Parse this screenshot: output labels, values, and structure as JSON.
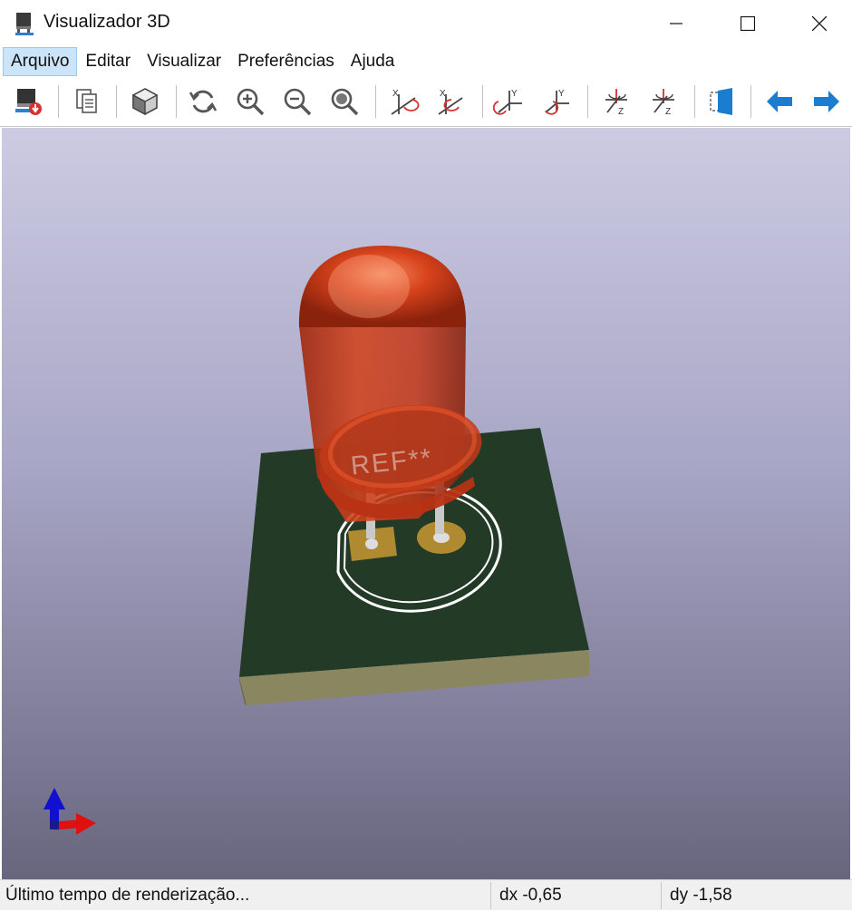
{
  "window": {
    "title": "Visualizador 3D"
  },
  "menu": [
    "Arquivo",
    "Editar",
    "Visualizar",
    "Preferências",
    "Ajuda"
  ],
  "viewport": {
    "silkscreen_text": "REF**"
  },
  "status": {
    "render_time": "Último tempo de renderização...",
    "dx": "dx -0,65",
    "dy": "dy -1,58"
  },
  "colors": {
    "board": "#233a27",
    "board_edge": "#8a8660",
    "led": "#d8401e",
    "pad": "#b08a30",
    "silkscreen": "#ffffff",
    "accent_blue": "#1a7dd0"
  }
}
